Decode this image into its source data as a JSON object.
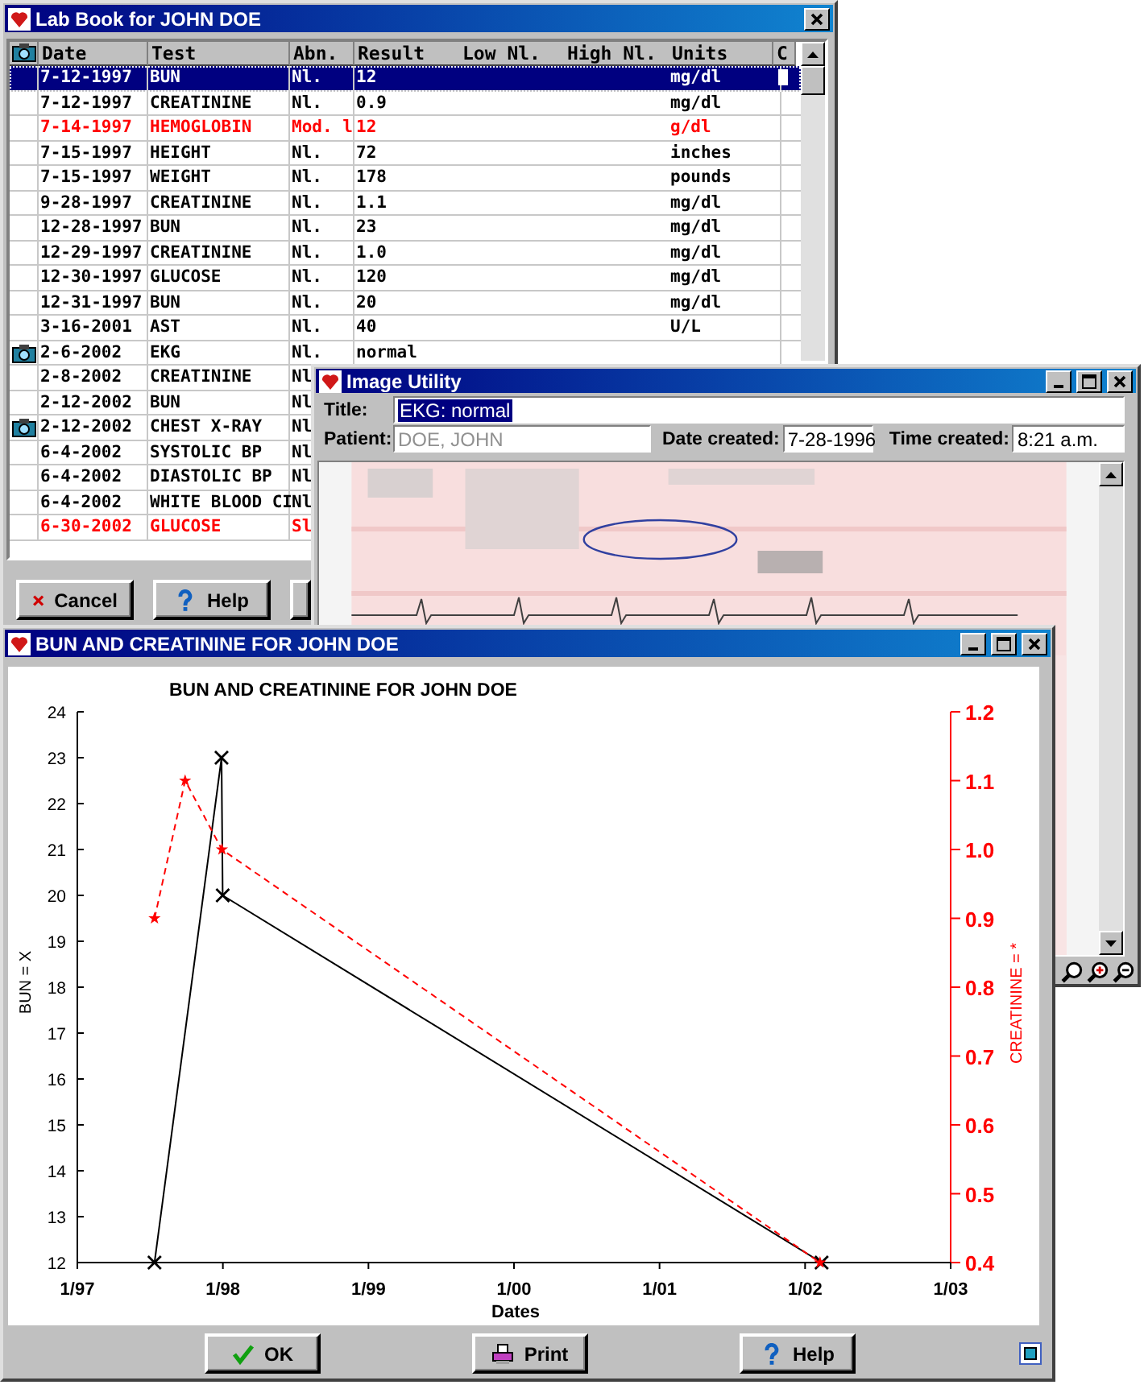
{
  "lab_book": {
    "title": "Lab Book for JOHN DOE",
    "columns": [
      {
        "label": "Date"
      },
      {
        "label": "Test",
        "kind": "text"
      },
      {
        "label": "Abn.",
        "kind": "text"
      },
      {
        "label": "Result",
        "kind": "text"
      },
      {
        "label": "Low Nl.",
        "kind": "text"
      },
      {
        "label": "High Nl.",
        "kind": "text"
      },
      {
        "label": "Units",
        "kind": "text"
      },
      {
        "label": "C",
        "kind": "text"
      }
    ],
    "rows": [
      {
        "date": "7-12-1997",
        "test": "BUN",
        "abn": "Nl.",
        "result": "12",
        "units": "mg/dl",
        "selected": true,
        "abnormal": false,
        "has_image": false
      },
      {
        "date": "7-12-1997",
        "test": "CREATININE",
        "abn": "Nl.",
        "result": "0.9",
        "units": "mg/dl",
        "selected": false,
        "abnormal": false,
        "has_image": false
      },
      {
        "date": "7-14-1997",
        "test": "HEMOGLOBIN",
        "abn": "Mod. l",
        "result": "12",
        "units": "g/dl",
        "selected": false,
        "abnormal": true,
        "has_image": false
      },
      {
        "date": "7-15-1997",
        "test": "HEIGHT",
        "abn": "Nl.",
        "result": "72",
        "units": "inches",
        "selected": false,
        "abnormal": false,
        "has_image": false
      },
      {
        "date": "7-15-1997",
        "test": "WEIGHT",
        "abn": "Nl.",
        "result": "178",
        "units": "pounds",
        "selected": false,
        "abnormal": false,
        "has_image": false
      },
      {
        "date": "9-28-1997",
        "test": "CREATININE",
        "abn": "Nl.",
        "result": "1.1",
        "units": "mg/dl",
        "selected": false,
        "abnormal": false,
        "has_image": false
      },
      {
        "date": "12-28-1997",
        "test": "BUN",
        "abn": "Nl.",
        "result": "23",
        "units": "mg/dl",
        "selected": false,
        "abnormal": false,
        "has_image": false
      },
      {
        "date": "12-29-1997",
        "test": "CREATININE",
        "abn": "Nl.",
        "result": "1.0",
        "units": "mg/dl",
        "selected": false,
        "abnormal": false,
        "has_image": false
      },
      {
        "date": "12-30-1997",
        "test": "GLUCOSE",
        "abn": "Nl.",
        "result": "120",
        "units": "mg/dl",
        "selected": false,
        "abnormal": false,
        "has_image": false
      },
      {
        "date": "12-31-1997",
        "test": "BUN",
        "abn": "Nl.",
        "result": "20",
        "units": "mg/dl",
        "selected": false,
        "abnormal": false,
        "has_image": false
      },
      {
        "date": "3-16-2001",
        "test": "AST",
        "abn": "Nl.",
        "result": "40",
        "units": "U/L",
        "selected": false,
        "abnormal": false,
        "has_image": false
      },
      {
        "date": "2-6-2002",
        "test": "EKG",
        "abn": "Nl.",
        "result": "normal",
        "selected": false,
        "abnormal": false,
        "has_image": true
      },
      {
        "date": "2-8-2002",
        "test": "CREATININE",
        "abn": "Nl",
        "selected": false,
        "abnormal": false,
        "has_image": false
      },
      {
        "date": "2-12-2002",
        "test": "BUN",
        "abn": "Nl",
        "selected": false,
        "abnormal": false,
        "has_image": false
      },
      {
        "date": "2-12-2002",
        "test": "CHEST X-RAY",
        "abn": "Nl",
        "selected": false,
        "abnormal": false,
        "has_image": true
      },
      {
        "date": "6-4-2002",
        "test": "SYSTOLIC BP",
        "abn": "Nl",
        "selected": false,
        "abnormal": false,
        "has_image": false
      },
      {
        "date": "6-4-2002",
        "test": "DIASTOLIC BP",
        "abn": "Nl",
        "selected": false,
        "abnormal": false,
        "has_image": false
      },
      {
        "date": "6-4-2002",
        "test": "WHITE BLOOD CI",
        "abn": "Nl",
        "selected": false,
        "abnormal": false,
        "has_image": false
      },
      {
        "date": "6-30-2002",
        "test": "GLUCOSE",
        "abn": "Sl",
        "selected": false,
        "abnormal": true,
        "has_image": false
      }
    ],
    "buttons": [
      {
        "kind": "cancel",
        "label": "Cancel"
      },
      {
        "kind": "help",
        "label": "Help"
      },
      {
        "kind": "blank"
      }
    ]
  },
  "image_utility": {
    "title": "Image Utility",
    "title_field": {
      "label": "Title:",
      "value": "EKG: normal",
      "text_selected": true
    },
    "patient_field": {
      "label": "Patient:",
      "value": "DOE, JOHN",
      "disabled": true
    },
    "date_field": {
      "label": "Date created:",
      "value": "7-28-1996"
    },
    "time_field": {
      "label": "Time created:",
      "value": "8:21 a.m."
    }
  },
  "chart_window": {
    "title": "BUN AND CREATININE FOR JOHN DOE",
    "chart_data": {
      "type": "line",
      "title": "BUN AND CREATININE FOR JOHN DOE",
      "xlabel": "Dates",
      "x": [
        "1997-07-12",
        "1997-09-28",
        "1997-12-28",
        "1997-12-29",
        "1997-12-31",
        "2002-02-08",
        "2002-02-12"
      ],
      "series": [
        {
          "name": "BUN = X",
          "color": "#000000",
          "marker": "cross",
          "line_style": "solid",
          "values": [
            12,
            null,
            23,
            null,
            20,
            null,
            12
          ]
        },
        {
          "name": "CREATININE = *",
          "color": "#ff0000",
          "axis": "y2",
          "marker": "star",
          "line_style": "dashed",
          "values": [
            0.9,
            1.1,
            null,
            1.0,
            null,
            0.4,
            null
          ]
        }
      ],
      "xlim": [
        "1997-01-01",
        "2003-01-01"
      ],
      "ylim": [
        12,
        24
      ],
      "y2lim": [
        0.4,
        1.2
      ],
      "xticks": [
        {
          "value": "1997-01-01",
          "label": "1/97"
        },
        {
          "value": "1998-01-01",
          "label": "1/98"
        },
        {
          "value": "1999-01-01",
          "label": "1/99"
        },
        {
          "value": "2000-01-01",
          "label": "1/00"
        },
        {
          "value": "2001-01-01",
          "label": "1/01"
        },
        {
          "value": "2002-01-01",
          "label": "1/02"
        },
        {
          "value": "2003-01-01",
          "label": "1/03"
        }
      ],
      "yticks": [
        12,
        13,
        14,
        15,
        16,
        17,
        18,
        19,
        20,
        21,
        22,
        23,
        24
      ],
      "y2ticks": [
        {
          "value": 0.4,
          "label": "0.4"
        },
        {
          "value": 0.5,
          "label": "0.5"
        },
        {
          "value": 0.6,
          "label": "0.6"
        },
        {
          "value": 0.7,
          "label": "0.7"
        },
        {
          "value": 0.8,
          "label": "0.8"
        },
        {
          "value": 0.9,
          "label": "0.9"
        },
        {
          "value": 1.0,
          "label": "1.0"
        },
        {
          "value": 1.1,
          "label": "1.1"
        },
        {
          "value": 1.2,
          "label": "1.2"
        }
      ]
    },
    "buttons": [
      {
        "kind": "ok",
        "label": "OK"
      },
      {
        "kind": "print",
        "label": "Print"
      },
      {
        "kind": "help",
        "label": "Help"
      }
    ]
  }
}
